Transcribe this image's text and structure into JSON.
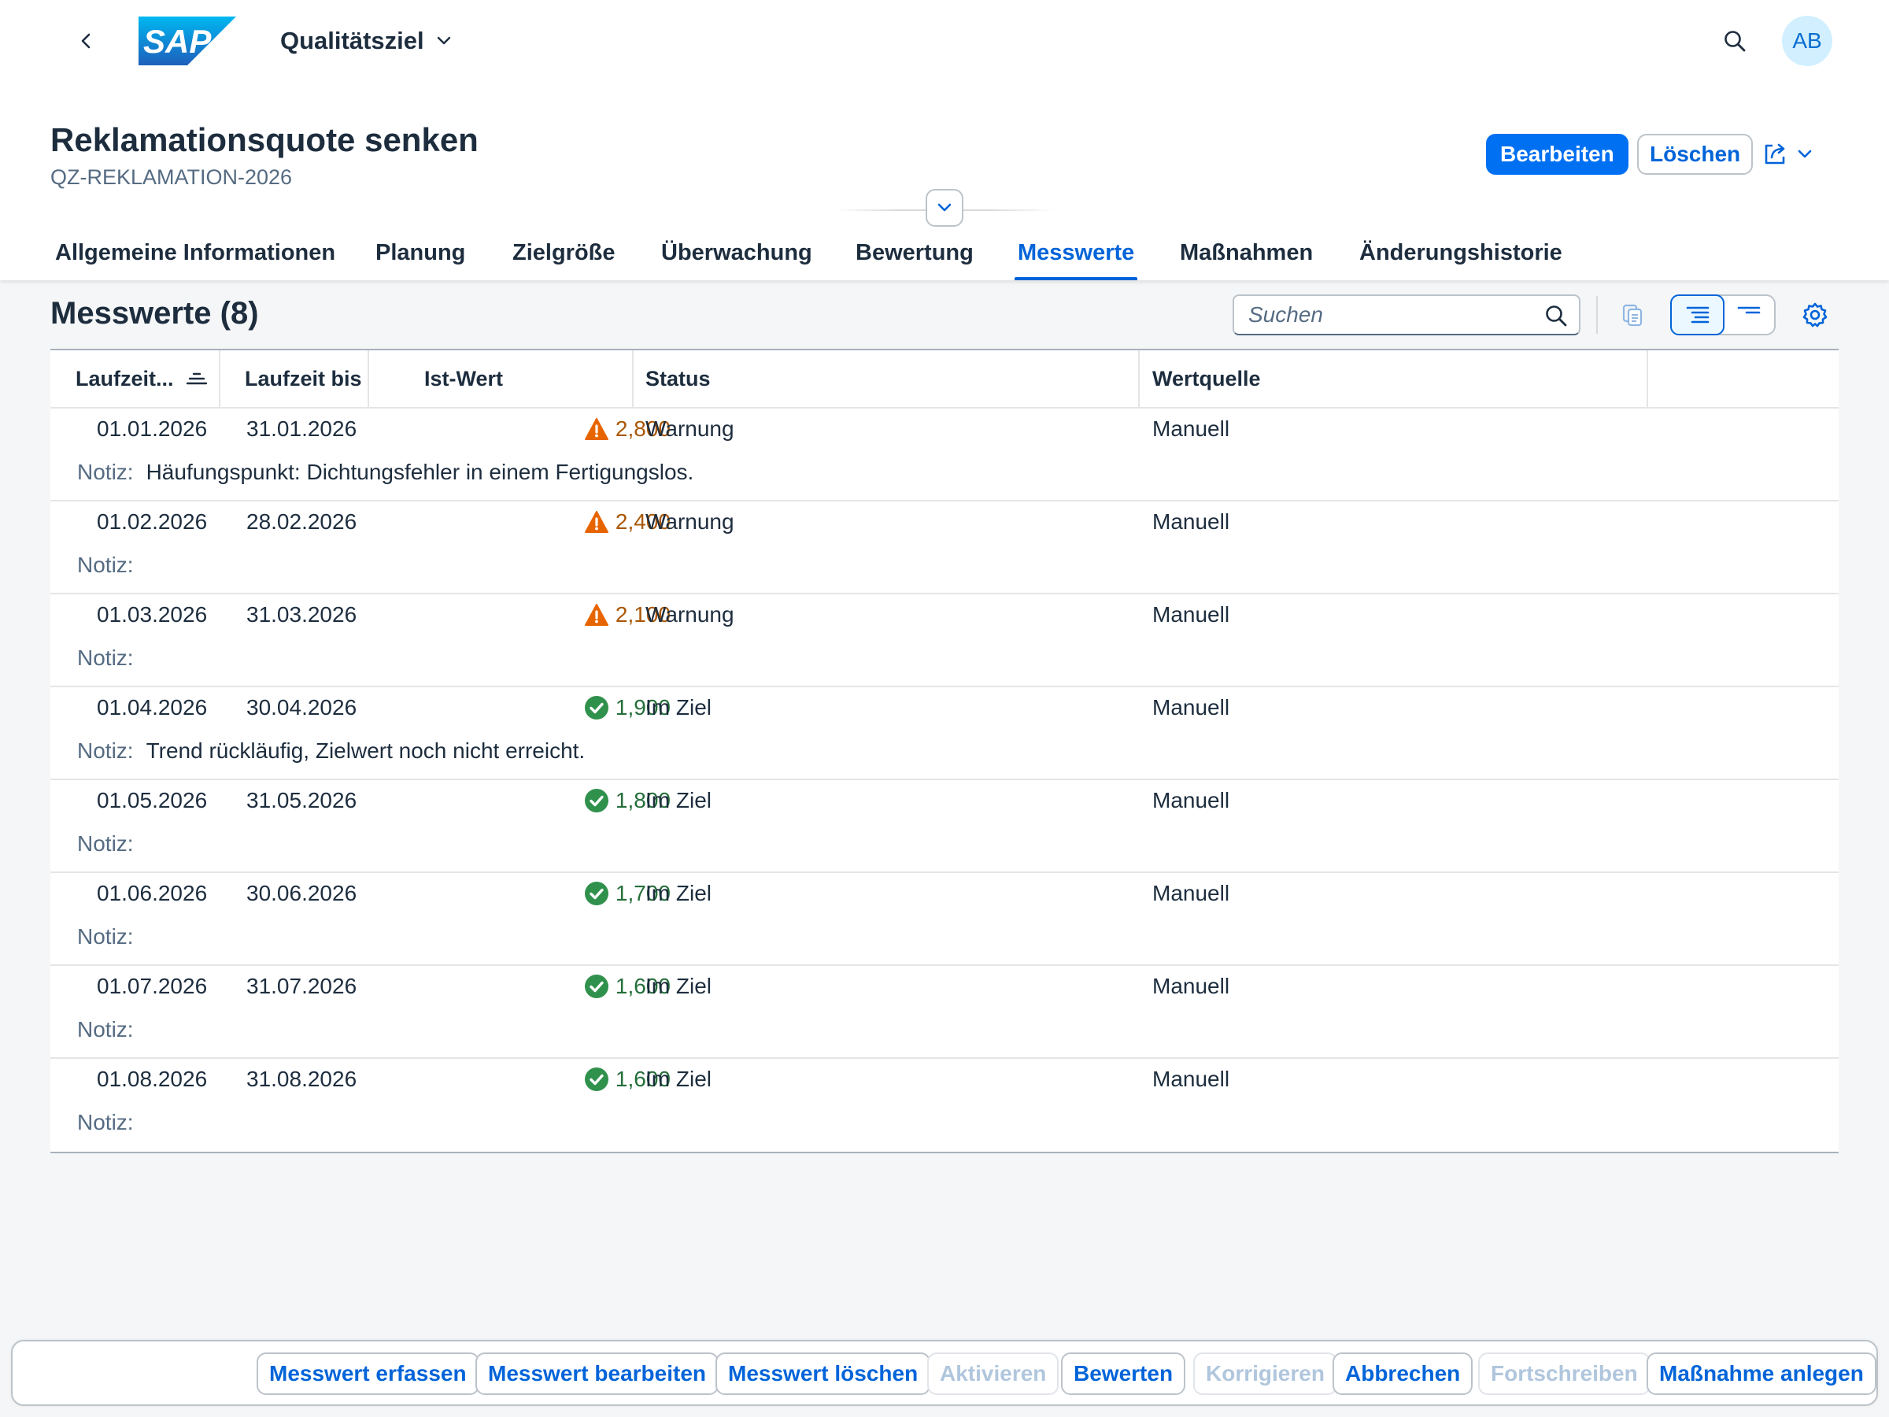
{
  "shell": {
    "app_title": "Qualitätsziel",
    "avatar_initials": "AB",
    "logo_text": "SAP"
  },
  "header": {
    "title": "Reklamationsquote senken",
    "subtitle": "QZ-REKLAMATION-2026",
    "edit_label": "Bearbeiten",
    "delete_label": "Löschen"
  },
  "tabs": [
    {
      "label": "Allgemeine Informationen",
      "active": false
    },
    {
      "label": "Planung",
      "active": false
    },
    {
      "label": "Zielgröße",
      "active": false
    },
    {
      "label": "Überwachung",
      "active": false
    },
    {
      "label": "Bewertung",
      "active": false
    },
    {
      "label": "Messwerte",
      "active": true
    },
    {
      "label": "Maßnahmen",
      "active": false
    },
    {
      "label": "Änderungshistorie",
      "active": false
    }
  ],
  "section": {
    "title": "Messwerte (8)",
    "search_placeholder": "Suchen"
  },
  "table": {
    "columns": [
      "Laufzeit...",
      "Laufzeit bis",
      "Ist-Wert",
      "Status",
      "Wertquelle"
    ],
    "note_label": "Notiz:",
    "rows": [
      {
        "from": "01.01.2026",
        "to": "31.01.2026",
        "value": "2,800",
        "status": "Warnung",
        "state": "warning",
        "source": "Manuell",
        "note": "Häufungspunkt: Dichtungsfehler in einem Fertigungslos."
      },
      {
        "from": "01.02.2026",
        "to": "28.02.2026",
        "value": "2,400",
        "status": "Warnung",
        "state": "warning",
        "source": "Manuell",
        "note": ""
      },
      {
        "from": "01.03.2026",
        "to": "31.03.2026",
        "value": "2,100",
        "status": "Warnung",
        "state": "warning",
        "source": "Manuell",
        "note": ""
      },
      {
        "from": "01.04.2026",
        "to": "30.04.2026",
        "value": "1,900",
        "status": "Im Ziel",
        "state": "success",
        "source": "Manuell",
        "note": "Trend rückläufig, Zielwert noch nicht erreicht."
      },
      {
        "from": "01.05.2026",
        "to": "31.05.2026",
        "value": "1,800",
        "status": "Im Ziel",
        "state": "success",
        "source": "Manuell",
        "note": ""
      },
      {
        "from": "01.06.2026",
        "to": "30.06.2026",
        "value": "1,700",
        "status": "Im Ziel",
        "state": "success",
        "source": "Manuell",
        "note": ""
      },
      {
        "from": "01.07.2026",
        "to": "31.07.2026",
        "value": "1,600",
        "status": "Im Ziel",
        "state": "success",
        "source": "Manuell",
        "note": ""
      },
      {
        "from": "01.08.2026",
        "to": "31.08.2026",
        "value": "1,600",
        "status": "Im Ziel",
        "state": "success",
        "source": "Manuell",
        "note": ""
      }
    ]
  },
  "footer": {
    "buttons": [
      {
        "label": "Messwert erfassen",
        "enabled": true
      },
      {
        "label": "Messwert bearbeiten",
        "enabled": true
      },
      {
        "label": "Messwert löschen",
        "enabled": true
      },
      {
        "label": "Aktivieren",
        "enabled": false
      },
      {
        "label": "Bewerten",
        "enabled": true
      },
      {
        "label": "Korrigieren",
        "enabled": false
      },
      {
        "label": "Abbrechen",
        "enabled": true
      },
      {
        "label": "Fortschreiben",
        "enabled": false
      },
      {
        "label": "Maßnahme anlegen",
        "enabled": true
      }
    ]
  },
  "colors": {
    "brand": "#0070f2",
    "link": "#0064d9",
    "warning": "#e76500",
    "warning_text": "#aa5808",
    "success": "#30914c",
    "success_text": "#256f3a"
  },
  "icons": {
    "back": "back-icon",
    "search": "search-icon",
    "share": "share-icon",
    "collapse": "chevron-down-icon",
    "copy": "copy-icon",
    "sort": "sort-icon",
    "settings": "settings-icon",
    "warning": "warning-icon",
    "success": "success-icon"
  }
}
